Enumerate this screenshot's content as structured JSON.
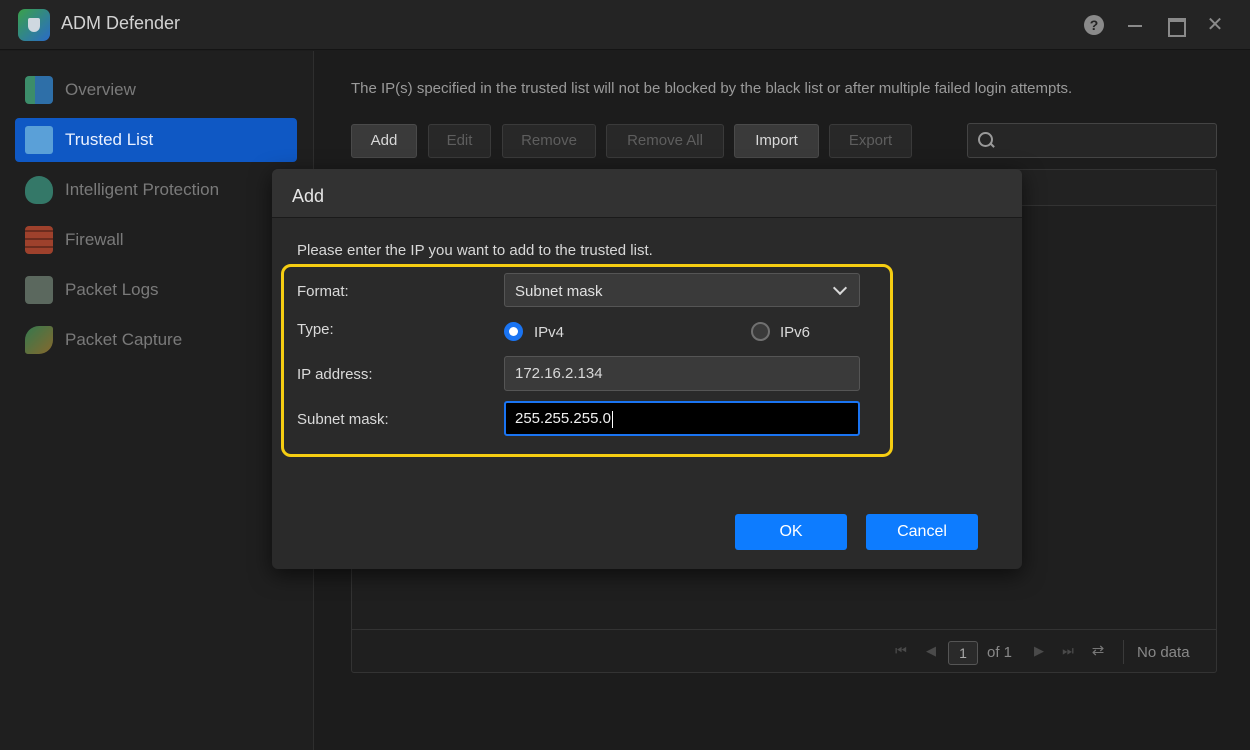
{
  "app": {
    "title": "ADM Defender"
  },
  "sidebar": {
    "items": [
      {
        "label": "Overview",
        "icon": "overview-icon",
        "active": false
      },
      {
        "label": "Trusted List",
        "icon": "trusted-list-icon",
        "active": true
      },
      {
        "label": "Intelligent Protection",
        "icon": "shield-icon",
        "active": false
      },
      {
        "label": "Firewall",
        "icon": "firewall-icon",
        "active": false
      },
      {
        "label": "Packet Logs",
        "icon": "clipboard-icon",
        "active": false
      },
      {
        "label": "Packet Capture",
        "icon": "packet-capture-icon",
        "active": false
      }
    ]
  },
  "main": {
    "description": "The IP(s) specified in the trusted list will not be blocked by the black list or after multiple failed login attempts.",
    "toolbar": {
      "add": "Add",
      "edit": "Edit",
      "remove": "Remove",
      "remove_all": "Remove All",
      "import": "Import",
      "export": "Export"
    },
    "search": {
      "placeholder": ""
    },
    "pagination": {
      "page": "1",
      "of": "of 1",
      "status": "No data"
    }
  },
  "dialog": {
    "title": "Add",
    "prompt": "Please enter the IP you want to add to the trusted list.",
    "format": {
      "label": "Format:",
      "value": "Subnet mask"
    },
    "type": {
      "label": "Type:",
      "ipv4": "IPv4",
      "ipv6": "IPv6",
      "selected": "IPv4"
    },
    "ip_address": {
      "label": "IP address:",
      "value": "172.16.2.134"
    },
    "subnet_mask": {
      "label": "Subnet mask:",
      "value": "255.255.255.0"
    },
    "ok": "OK",
    "cancel": "Cancel"
  },
  "colors": {
    "accent": "#0d7cff",
    "active_nav": "#0f58c4",
    "highlight": "#f5cd12"
  }
}
